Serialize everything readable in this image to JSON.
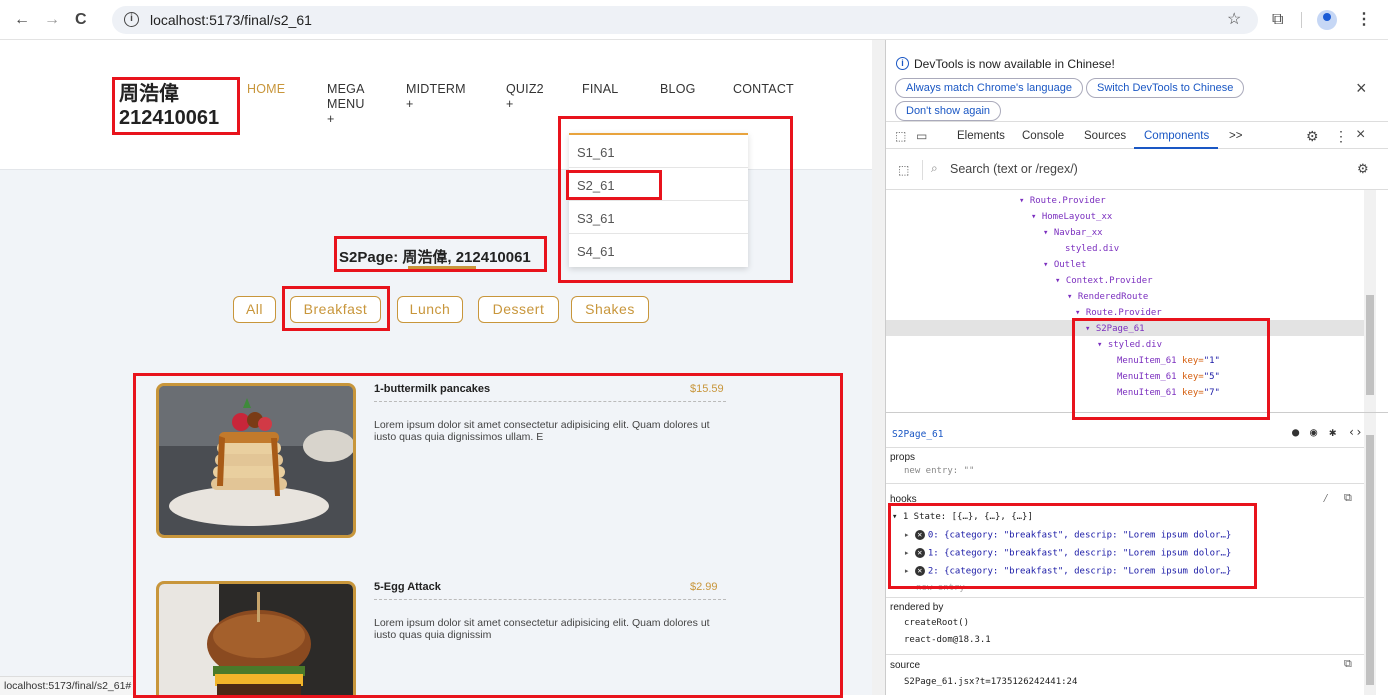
{
  "browser": {
    "url": "localhost:5173/final/s2_61",
    "back_icon": "←",
    "forward_icon": "→",
    "reload_icon": "C",
    "star_icon": "☆",
    "extensions_icon": "⧉",
    "menu_icon": "⋮"
  },
  "page": {
    "student": {
      "name": "周浩偉",
      "id": "212410061"
    },
    "nav": [
      {
        "label": "HOME",
        "sub": ""
      },
      {
        "label": "MEGA",
        "sub": "MENU"
      },
      {
        "label": "MIDTERM",
        "sub": ""
      },
      {
        "label": "QUIZ2",
        "sub": ""
      },
      {
        "label": "FINAL",
        "sub": ""
      },
      {
        "label": "BLOG",
        "sub": ""
      },
      {
        "label": "CONTACT",
        "sub": ""
      }
    ],
    "nav_plus": "+",
    "dropdown": [
      "S1_61",
      "S2_61",
      "S3_61",
      "S4_61"
    ],
    "title": "S2Page: 周浩偉, 212410061",
    "filters": [
      "All",
      "Breakfast",
      "Lunch",
      "Dessert",
      "Shakes"
    ],
    "items": [
      {
        "name": "1-buttermilk pancakes",
        "price": "$15.59",
        "desc": "Lorem ipsum dolor sit amet consectetur adipisicing elit. Quam dolores ut iusto quas quia dignissimos ullam. E"
      },
      {
        "name": "5-Egg Attack",
        "price": "$2.99",
        "desc": "Lorem ipsum dolor sit amet consectetur adipisicing elit. Quam dolores ut iusto quas quia dignissim"
      }
    ],
    "status_url": "localhost:5173/final/s2_61#"
  },
  "devtools": {
    "banner": "DevTools is now available in Chinese!",
    "btn_match": "Always match Chrome's language",
    "btn_switch": "Switch DevTools to Chinese",
    "btn_dont": "Don't show again",
    "close": "×",
    "tabs": [
      "Elements",
      "Console",
      "Sources",
      "Components",
      ">>"
    ],
    "search_placeholder": "Search (text or /regex/)",
    "tree": [
      "▾ Route.Provider",
      "▾ HomeLayout_xx",
      "▾ Navbar_xx",
      "styled.div",
      "▾ Outlet",
      "▾ Context.Provider",
      "▾ RenderedRoute",
      "▾ Route.Provider",
      "▾ S2Page_61",
      "▾ styled.div"
    ],
    "menu_items": [
      {
        "name": "MenuItem_61",
        "key": "key=",
        "val": "\"1\""
      },
      {
        "name": "MenuItem_61",
        "key": "key=",
        "val": "\"5\""
      },
      {
        "name": "MenuItem_61",
        "key": "key=",
        "val": "\"7\""
      }
    ],
    "selected": "S2Page_61",
    "props_label": "props",
    "props_entry": "new entry: \"\"",
    "hooks_label": "hooks",
    "state_line": "▾ 1 State: [{…}, {…}, {…}]",
    "hook_rows": [
      "0: {category: \"breakfast\", descrip: \"Lorem ipsum dolor…}",
      "1: {category: \"breakfast\", descrip: \"Lorem ipsum dolor…}",
      "2: {category: \"breakfast\", descrip: \"Lorem ipsum dolor…}"
    ],
    "new_entry": "new entry",
    "rendered_by": "rendered by",
    "create_root": "createRoot()",
    "react_dom": "react-dom@18.3.1",
    "source": "source",
    "source_file": "S2Page_61.jsx?t=1735126242441:24"
  }
}
